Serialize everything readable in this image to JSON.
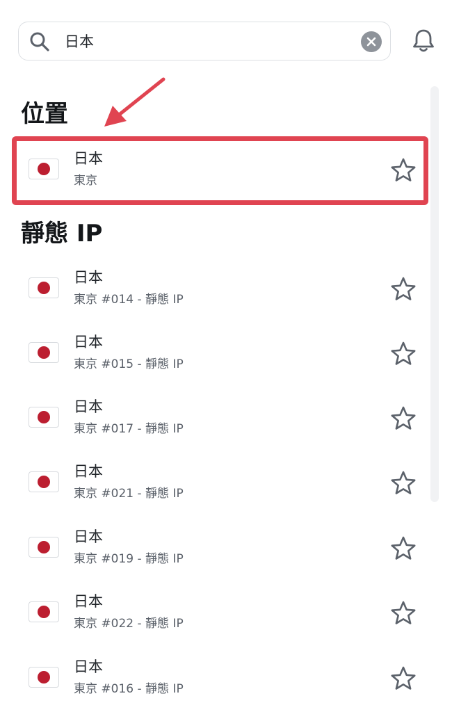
{
  "search": {
    "value": "日本",
    "placeholder": ""
  },
  "sections": {
    "locations_title": "位置",
    "static_ip_title": "靜態 IP"
  },
  "locations": [
    {
      "country": "日本",
      "city": "東京"
    }
  ],
  "static_ips": [
    {
      "country": "日本",
      "city": "東京 #014 - 靜態 IP"
    },
    {
      "country": "日本",
      "city": "東京 #015 - 靜態 IP"
    },
    {
      "country": "日本",
      "city": "東京 #017 - 靜態 IP"
    },
    {
      "country": "日本",
      "city": "東京 #021 - 靜態 IP"
    },
    {
      "country": "日本",
      "city": "東京 #019 - 靜態 IP"
    },
    {
      "country": "日本",
      "city": "東京 #022 - 靜態 IP"
    },
    {
      "country": "日本",
      "city": "東京 #016 - 靜態 IP"
    }
  ],
  "icons": {
    "search": "search-icon",
    "clear": "clear-icon",
    "bell": "bell-icon",
    "flag": "japan-flag-icon",
    "favorite": "star-icon"
  },
  "colors": {
    "annotation": "#e04451",
    "flag_red": "#bc1e30",
    "icon_gray": "#5b616a"
  }
}
